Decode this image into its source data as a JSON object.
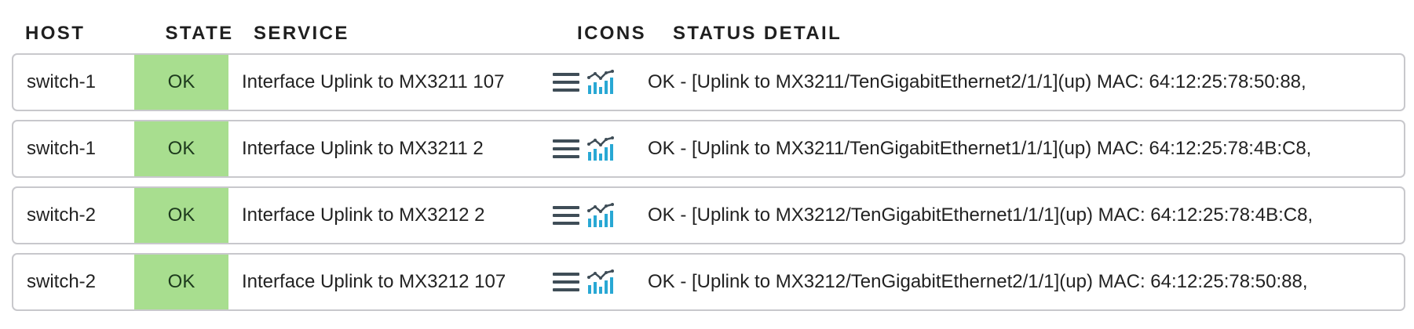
{
  "headers": {
    "host": "HOST",
    "state": "STATE",
    "service": "SERVICE",
    "icons": "ICONS",
    "detail": "STATUS DETAIL"
  },
  "icons": [
    "menu-icon",
    "graph-icon"
  ],
  "colors": {
    "ok_state": "#a8de8f",
    "icon_dark": "#3f4d57",
    "icon_accent": "#29a8d4"
  },
  "rows": [
    {
      "host": "switch-1",
      "state": "OK",
      "service": "Interface Uplink to MX3211 107",
      "detail": "OK - [Uplink to MX3211/TenGigabitEthernet2/1/1](up) MAC: 64:12:25:78:50:88,"
    },
    {
      "host": "switch-1",
      "state": "OK",
      "service": "Interface Uplink to MX3211 2",
      "detail": "OK - [Uplink to MX3211/TenGigabitEthernet1/1/1](up) MAC: 64:12:25:78:4B:C8,"
    },
    {
      "host": "switch-2",
      "state": "OK",
      "service": "Interface Uplink to MX3212 2",
      "detail": "OK - [Uplink to MX3212/TenGigabitEthernet1/1/1](up) MAC: 64:12:25:78:4B:C8,"
    },
    {
      "host": "switch-2",
      "state": "OK",
      "service": "Interface Uplink to MX3212 107",
      "detail": "OK - [Uplink to MX3212/TenGigabitEthernet2/1/1](up) MAC: 64:12:25:78:50:88,"
    }
  ]
}
